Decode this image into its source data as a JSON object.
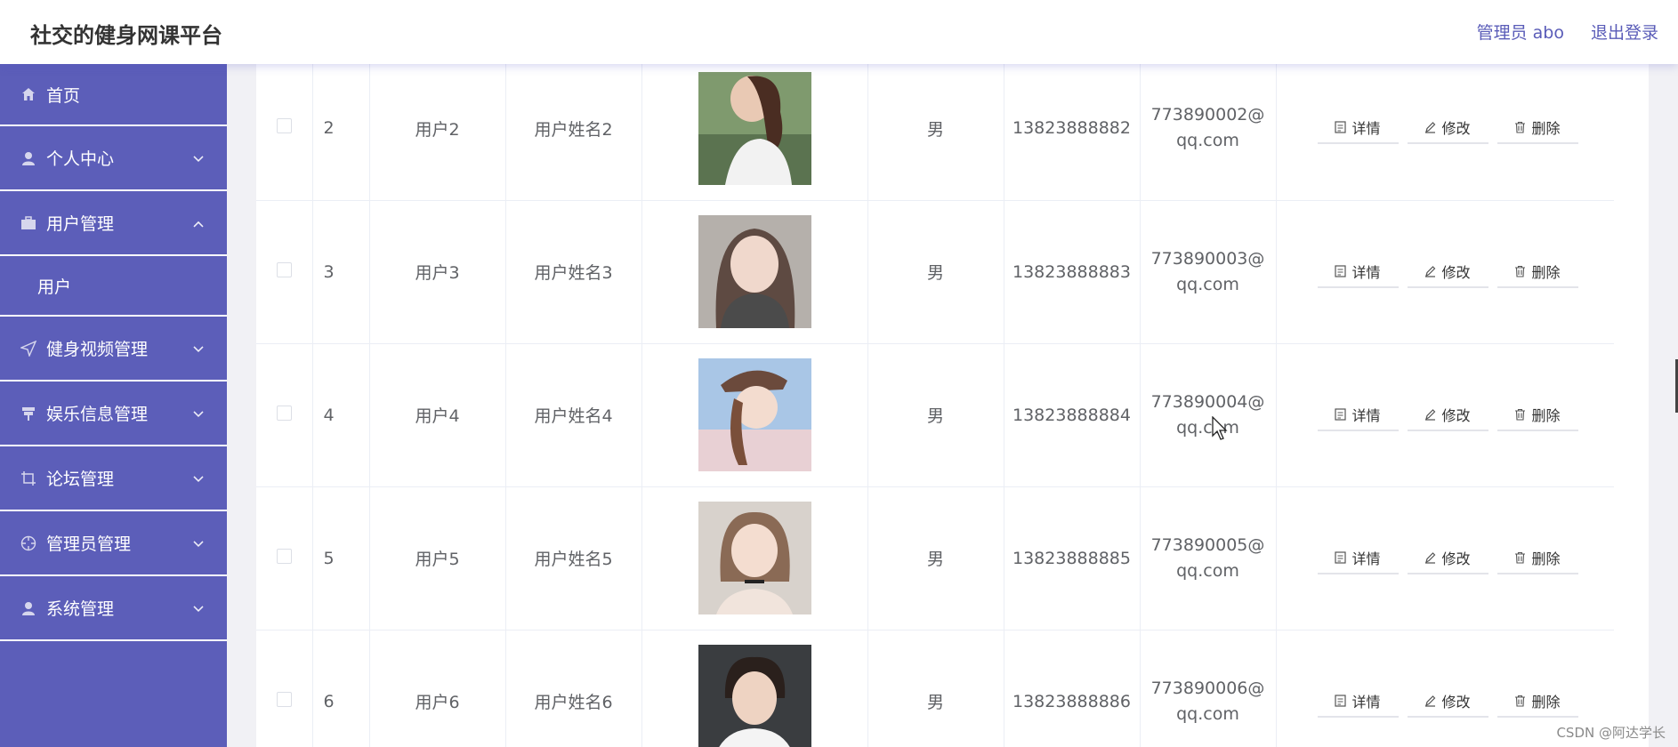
{
  "header": {
    "app_title": "社交的健身网课平台",
    "admin_label": "管理员 abo",
    "logout_label": "退出登录"
  },
  "sidebar": {
    "items": [
      {
        "label": "首页",
        "icon": "home-icon"
      },
      {
        "label": "个人中心",
        "icon": "user-icon"
      },
      {
        "label": "用户管理",
        "icon": "briefcase-icon",
        "expanded": true,
        "children": [
          {
            "label": "用户"
          }
        ]
      },
      {
        "label": "健身视频管理",
        "icon": "send-icon"
      },
      {
        "label": "娱乐信息管理",
        "icon": "pin-icon"
      },
      {
        "label": "论坛管理",
        "icon": "crop-icon"
      },
      {
        "label": "管理员管理",
        "icon": "crosshair-icon"
      },
      {
        "label": "系统管理",
        "icon": "user-icon"
      }
    ]
  },
  "table": {
    "rows": [
      {
        "index": "2",
        "account": "用户2",
        "name": "用户姓名2",
        "gender": "男",
        "phone": "13823888882",
        "email": "773890002@qq.com",
        "avatar": "avatar-photo-2"
      },
      {
        "index": "3",
        "account": "用户3",
        "name": "用户姓名3",
        "gender": "男",
        "phone": "13823888883",
        "email": "773890003@qq.com",
        "avatar": "avatar-photo-3"
      },
      {
        "index": "4",
        "account": "用户4",
        "name": "用户姓名4",
        "gender": "男",
        "phone": "13823888884",
        "email": "773890004@qq.com",
        "avatar": "avatar-photo-4"
      },
      {
        "index": "5",
        "account": "用户5",
        "name": "用户姓名5",
        "gender": "男",
        "phone": "13823888885",
        "email": "773890005@qq.com",
        "avatar": "avatar-photo-5"
      },
      {
        "index": "6",
        "account": "用户6",
        "name": "用户姓名6",
        "gender": "男",
        "phone": "13823888886",
        "email": "773890006@qq.com",
        "avatar": "avatar-photo-6"
      }
    ],
    "actions": {
      "detail": "详情",
      "edit": "修改",
      "delete": "删除"
    }
  },
  "watermark": "CSDN @阿达学长",
  "colors": {
    "sidebar": "#5c5eb9",
    "header_text": "#5a5cb8",
    "accent": "#5c5eb9"
  }
}
